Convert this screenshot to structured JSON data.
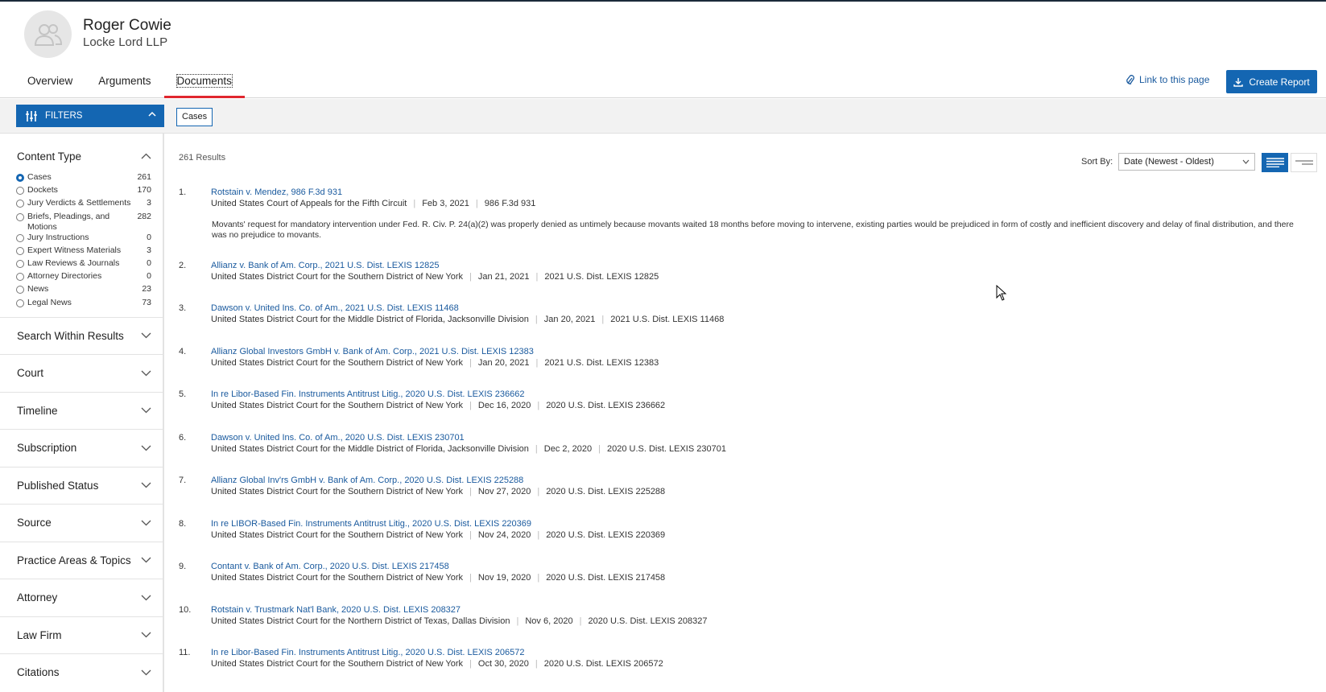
{
  "profile": {
    "name": "Roger Cowie",
    "firm": "Locke Lord LLP"
  },
  "tabs": [
    {
      "label": "Overview"
    },
    {
      "label": "Arguments"
    },
    {
      "label": "Documents"
    }
  ],
  "actions": {
    "link_label": "Link to this page",
    "report_label": "Create Report"
  },
  "filterbar": {
    "filters_label": "FILTERS",
    "chip_label": "Cases"
  },
  "sidebar": {
    "content_type_label": "Content Type",
    "content_types": [
      {
        "label": "Cases",
        "count": "261"
      },
      {
        "label": "Dockets",
        "count": "170"
      },
      {
        "label": "Jury Verdicts & Settlements",
        "count": "3"
      },
      {
        "label": "Briefs, Pleadings, and Motions",
        "count": "282"
      },
      {
        "label": "Jury Instructions",
        "count": "0"
      },
      {
        "label": "Expert Witness Materials",
        "count": "3"
      },
      {
        "label": "Law Reviews & Journals",
        "count": "0"
      },
      {
        "label": "Attorney Directories",
        "count": "0"
      },
      {
        "label": "News",
        "count": "23"
      },
      {
        "label": "Legal News",
        "count": "73"
      }
    ],
    "sections": [
      "Search Within Results",
      "Court",
      "Timeline",
      "Subscription",
      "Published Status",
      "Source",
      "Practice Areas & Topics",
      "Attorney",
      "Law Firm",
      "Citations"
    ]
  },
  "results": {
    "count_label": "261 Results",
    "sort_label": "Sort By:",
    "sort_value": "Date (Newest - Oldest)",
    "items": [
      {
        "num": "1.",
        "title": "Rotstain v. Mendez, 986 F.3d 931",
        "court": "United States Court of Appeals for the Fifth Circuit",
        "date": "Feb 3, 2021",
        "cite": "986 F.3d 931",
        "summary": "Movants' request for mandatory intervention under Fed. R. Civ. P. 24(a)(2) was properly denied as untimely because movants waited 18 months before moving to intervene, existing parties would be prejudiced in form of costly and inefficient discovery and delay of final distribution, and there was no prejudice to movants."
      },
      {
        "num": "2.",
        "title": "Allianz v. Bank of Am. Corp., 2021 U.S. Dist. LEXIS 12825",
        "court": "United States District Court for the Southern District of New York",
        "date": "Jan 21, 2021",
        "cite": "2021 U.S. Dist. LEXIS 12825"
      },
      {
        "num": "3.",
        "title": "Dawson v. United Ins. Co. of Am., 2021 U.S. Dist. LEXIS 11468",
        "court": "United States District Court for the Middle District of Florida, Jacksonville Division",
        "date": "Jan 20, 2021",
        "cite": "2021 U.S. Dist. LEXIS 11468"
      },
      {
        "num": "4.",
        "title": "Allianz Global Investors GmbH v. Bank of Am. Corp., 2021 U.S. Dist. LEXIS 12383",
        "court": "United States District Court for the Southern District of New York",
        "date": "Jan 20, 2021",
        "cite": "2021 U.S. Dist. LEXIS 12383"
      },
      {
        "num": "5.",
        "title": "In re Libor-Based Fin. Instruments Antitrust Litig., 2020 U.S. Dist. LEXIS 236662",
        "court": "United States District Court for the Southern District of New York",
        "date": "Dec 16, 2020",
        "cite": "2020 U.S. Dist. LEXIS 236662"
      },
      {
        "num": "6.",
        "title": "Dawson v. United Ins. Co. of Am., 2020 U.S. Dist. LEXIS 230701",
        "court": "United States District Court for the Middle District of Florida, Jacksonville Division",
        "date": "Dec 2, 2020",
        "cite": "2020 U.S. Dist. LEXIS 230701"
      },
      {
        "num": "7.",
        "title": "Allianz Global Inv'rs GmbH v. Bank of Am. Corp., 2020 U.S. Dist. LEXIS 225288",
        "court": "United States District Court for the Southern District of New York",
        "date": "Nov 27, 2020",
        "cite": "2020 U.S. Dist. LEXIS 225288"
      },
      {
        "num": "8.",
        "title": "In re LIBOR-Based Fin. Instruments Antitrust Litig., 2020 U.S. Dist. LEXIS 220369",
        "court": "United States District Court for the Southern District of New York",
        "date": "Nov 24, 2020",
        "cite": "2020 U.S. Dist. LEXIS 220369"
      },
      {
        "num": "9.",
        "title": "Contant v. Bank of Am. Corp., 2020 U.S. Dist. LEXIS 217458",
        "court": "United States District Court for the Southern District of New York",
        "date": "Nov 19, 2020",
        "cite": "2020 U.S. Dist. LEXIS 217458"
      },
      {
        "num": "10.",
        "title": "Rotstain v. Trustmark Nat'l Bank, 2020 U.S. Dist. LEXIS 208327",
        "court": "United States District Court for the Northern District of Texas, Dallas Division",
        "date": "Nov 6, 2020",
        "cite": "2020 U.S. Dist. LEXIS 208327"
      },
      {
        "num": "11.",
        "title": "In re Libor-Based Fin. Instruments Antitrust Litig., 2020 U.S. Dist. LEXIS 206572",
        "court": "United States District Court for the Southern District of New York",
        "date": "Oct 30, 2020",
        "cite": "2020 U.S. Dist. LEXIS 206572"
      }
    ]
  }
}
